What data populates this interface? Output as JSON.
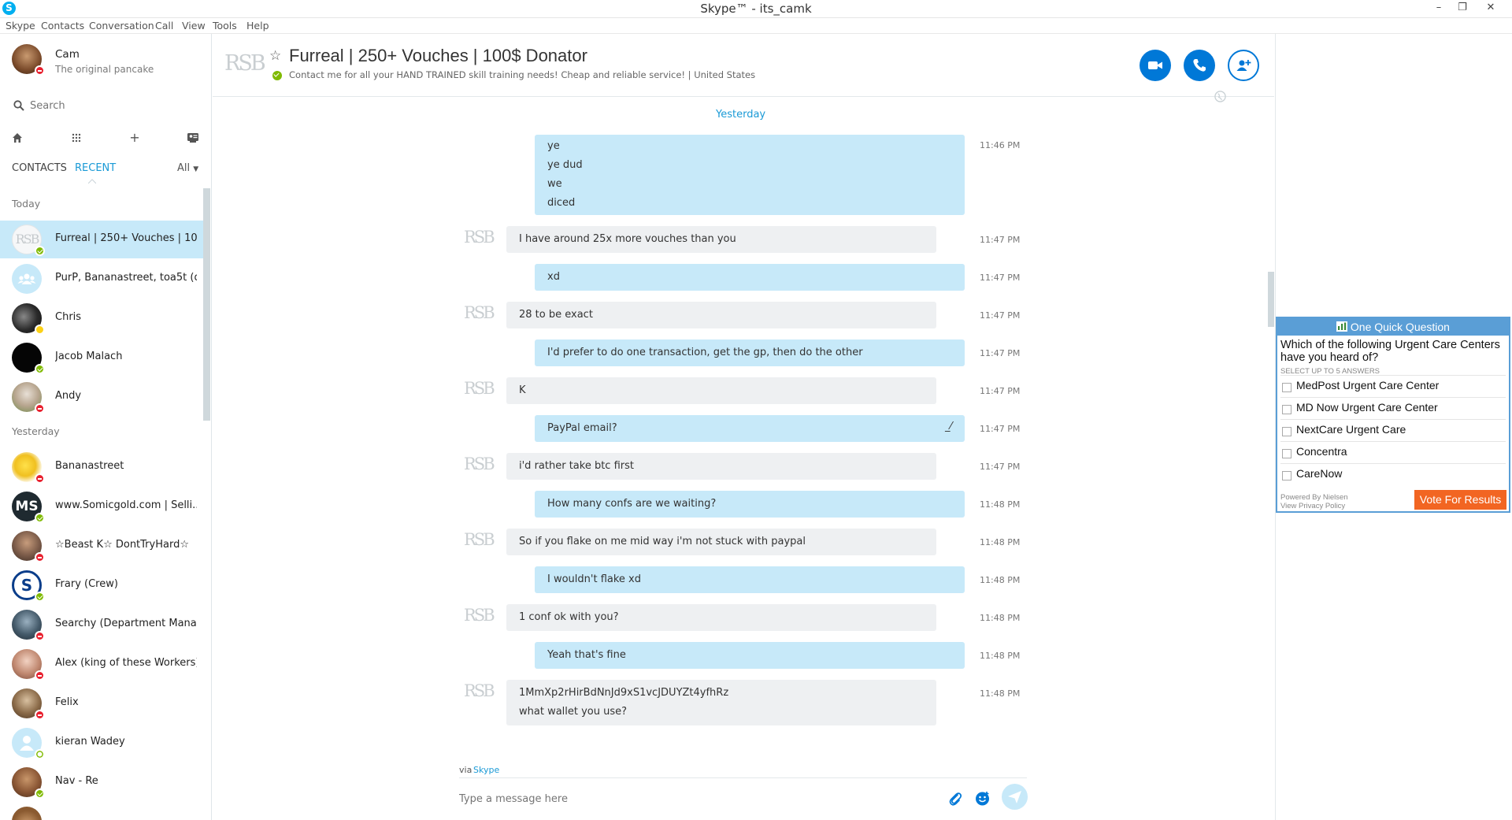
{
  "window": {
    "title": "Skype™ - its_camk"
  },
  "menu": [
    "Skype",
    "Contacts",
    "Conversation",
    "Call",
    "View",
    "Tools",
    "Help"
  ],
  "profile": {
    "name": "Cam",
    "mood": "The original pancake"
  },
  "search": {
    "placeholder": "Search"
  },
  "tabs": {
    "contacts": "CONTACTS",
    "recent": "RECENT",
    "filter": "All"
  },
  "sections": {
    "today": "Today",
    "yesterday": "Yesterday"
  },
  "contacts_today": [
    {
      "name": "Furreal | 250+ Vouches | 10...",
      "status": "online"
    },
    {
      "name": "PurP, Bananastreet, toa5t (d...",
      "status": "none"
    },
    {
      "name": "Chris",
      "status": "away"
    },
    {
      "name": "Jacob Malach",
      "status": "online"
    },
    {
      "name": "Andy",
      "status": "dnd"
    }
  ],
  "contacts_yesterday": [
    {
      "name": "Bananastreet",
      "status": "dnd"
    },
    {
      "name": "www.Somicgold.com  | Selli...",
      "status": "online"
    },
    {
      "name": "☆Beast K☆ DontTryHard☆",
      "status": "dnd"
    },
    {
      "name": "Frary (Crew)",
      "status": "online"
    },
    {
      "name": "Searchy (Department Mana...",
      "status": "dnd"
    },
    {
      "name": "Alex (king of these Workers)",
      "status": "dnd"
    },
    {
      "name": "Felix",
      "status": "dnd"
    },
    {
      "name": "kieran Wadey",
      "status": "offline"
    },
    {
      "name": "Nav - Re",
      "status": "online"
    }
  ],
  "conversation": {
    "avatar_text": "RSB",
    "title": "Furreal | 250+ Vouches | 100$ Donator",
    "mood": "Contact me for all your HAND TRAINED skill training needs! Cheap and reliable service!  |  United States",
    "date_divider": "Yesterday"
  },
  "messages": [
    {
      "dir": "out",
      "lines": [
        "ye",
        "ye dud",
        "we",
        "diced"
      ],
      "time": "11:46 PM"
    },
    {
      "dir": "in",
      "lines": [
        "I have around 25x more vouches than you"
      ],
      "time": "11:47 PM"
    },
    {
      "dir": "out",
      "lines": [
        "xd"
      ],
      "time": "11:47 PM"
    },
    {
      "dir": "in",
      "lines": [
        "28 to be exact"
      ],
      "time": "11:47 PM"
    },
    {
      "dir": "out",
      "lines": [
        "I'd prefer to do one transaction, get the gp, then do the other"
      ],
      "time": "11:47 PM"
    },
    {
      "dir": "in",
      "lines": [
        "K"
      ],
      "time": "11:47 PM"
    },
    {
      "dir": "out",
      "lines": [
        "PayPal email?"
      ],
      "time": "11:47 PM"
    },
    {
      "dir": "in",
      "lines": [
        "i'd rather take btc first"
      ],
      "time": "11:47 PM"
    },
    {
      "dir": "out",
      "lines": [
        "How many confs are we waiting?"
      ],
      "time": "11:48 PM"
    },
    {
      "dir": "in",
      "lines": [
        "So if you flake on me mid way i'm not stuck with paypal"
      ],
      "time": "11:48 PM"
    },
    {
      "dir": "out",
      "lines": [
        "I wouldn't flake xd"
      ],
      "time": "11:48 PM"
    },
    {
      "dir": "in",
      "lines": [
        "1 conf ok with you?"
      ],
      "time": "11:48 PM"
    },
    {
      "dir": "out",
      "lines": [
        "Yeah that's fine"
      ],
      "time": "11:48 PM"
    },
    {
      "dir": "in",
      "lines": [
        "1MmXp2rHirBdNnJd9xS1vcJDUYZt4yfhRz",
        "what wallet you use?"
      ],
      "time": "11:48 PM"
    }
  ],
  "composer": {
    "via_label": "via",
    "via_link": "Skype",
    "placeholder": "Type a message here"
  },
  "poll": {
    "header": "One Quick Question",
    "question": "Which of the following Urgent Care Centers have you heard of?",
    "sub": "SELECT UP TO 5 ANSWERS",
    "options": [
      "MedPost Urgent Care Center",
      "MD Now Urgent Care Center",
      "NextCare Urgent Care",
      "Concentra",
      "CareNow"
    ],
    "powered": "Powered By Nielsen",
    "privacy": "View Privacy Policy",
    "vote": "Vote For Results"
  },
  "colors": {
    "accent": "#00aff0",
    "outgoing_bubble": "#c7e9f9",
    "incoming_bubble": "#eef0f2",
    "header_button": "#0078d7",
    "dnd": "#e8202e",
    "online": "#7fba00",
    "away": "#fcd116",
    "vote_button": "#f26522"
  },
  "icons": [
    "skype-logo-icon",
    "search-icon",
    "home-icon",
    "dialpad-icon",
    "plus-icon",
    "contacts-book-icon",
    "star-icon",
    "video-call-icon",
    "call-icon",
    "add-contact-icon",
    "globe-icon",
    "attach-icon",
    "emoticon-icon",
    "send-icon",
    "poll-chart-icon"
  ]
}
